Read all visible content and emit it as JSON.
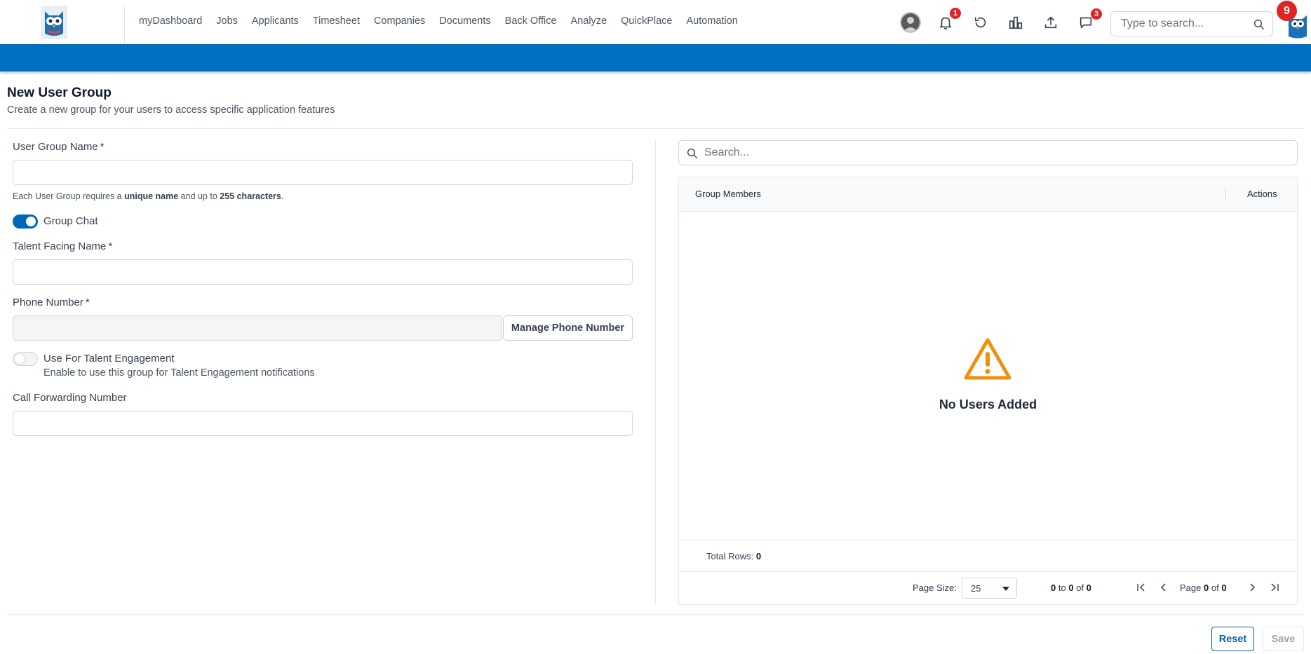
{
  "nav": {
    "links": [
      "myDashboard",
      "Jobs",
      "Applicants",
      "Timesheet",
      "Companies",
      "Documents",
      "Back Office",
      "Analyze",
      "QuickPlace",
      "Automation"
    ],
    "notifications_badge": "1",
    "messages_badge": "3",
    "search_placeholder": "Type to search...",
    "app_badge": "9"
  },
  "page": {
    "title": "New User Group",
    "subtitle": "Create a new group for your users to access specific application features"
  },
  "form": {
    "group_name_label": "User Group Name",
    "required_mark": "*",
    "group_name_value": "",
    "help_prefix": "Each User Group requires a ",
    "help_bold1": "unique name",
    "help_mid": " and up to ",
    "help_bold2": "255 characters",
    "help_suffix": ".",
    "group_chat_label": "Group Chat",
    "group_chat_on": true,
    "talent_name_label": "Talent Facing Name",
    "talent_name_value": "",
    "phone_label": "Phone Number",
    "phone_value": "",
    "manage_phone_button": "Manage Phone Number",
    "talent_engagement_label": "Use For Talent Engagement",
    "talent_engagement_desc": "Enable to use this group for Talent Engagement notifications",
    "talent_engagement_on": false,
    "call_forward_label": "Call Forwarding Number",
    "call_forward_value": ""
  },
  "members": {
    "search_placeholder": "Search...",
    "col_members": "Group Members",
    "col_actions": "Actions",
    "empty_text": "No Users Added",
    "total_rows_label": "Total Rows:",
    "total_rows": "0",
    "page_size_label": "Page Size:",
    "page_size": "25",
    "range_from": "0",
    "range_to_word": "to",
    "range_to": "0",
    "range_of_word": "of",
    "range_total": "0",
    "page_word": "Page",
    "page_current": "0",
    "page_of_word": "of",
    "page_total": "0"
  },
  "footer": {
    "reset_button": "Reset",
    "save_button": "Save"
  },
  "colors": {
    "brand_blue": "#0070c0",
    "toggle_on": "#0067b8",
    "badge_red": "#e02424",
    "warning_orange": "#f0900c"
  }
}
